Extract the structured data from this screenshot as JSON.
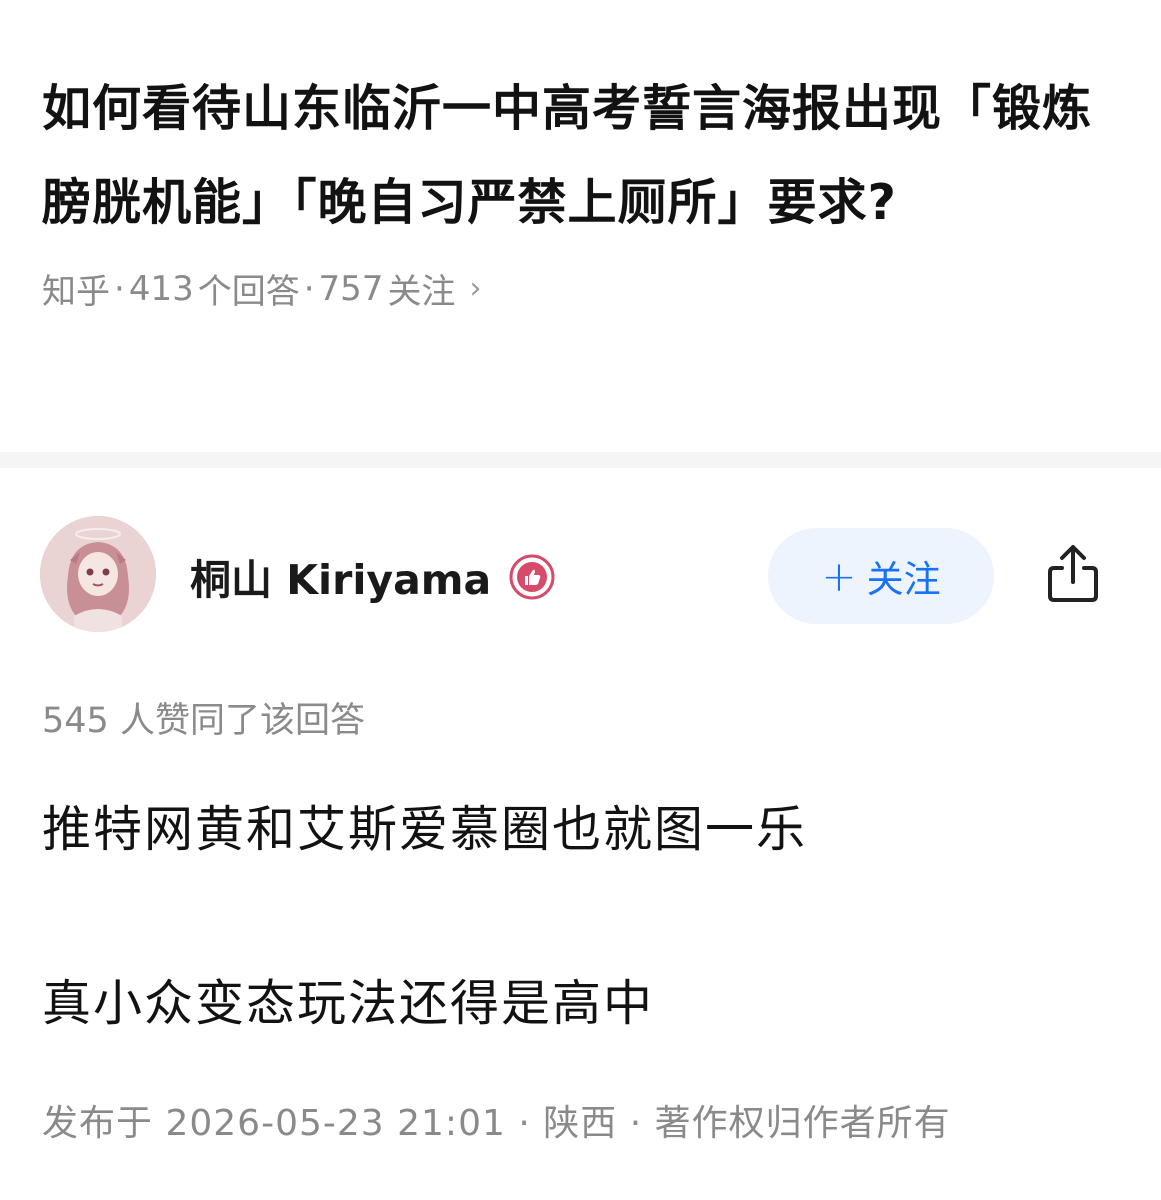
{
  "question": {
    "title": "如何看待山东临沂一中高考誓言海报出现「锻炼膀胱机能」「晚自习严禁上厕所」要求?",
    "source": "知乎",
    "answers_count": "413",
    "answers_label": "个回答",
    "followers_count": "757",
    "followers_label": "关注",
    "separator": "·"
  },
  "author": {
    "name": "桐山 Kiriyama",
    "badge_icon": "thumbs-up-badge-icon",
    "follow_label": "关注",
    "follow_plus": "+",
    "share_icon": "share-icon"
  },
  "answer": {
    "upvote_count": "545",
    "upvote_label": "人赞同了该回答",
    "paragraphs": [
      "推特网黄和艾斯爱慕圈也就图一乐",
      "真小众变态玩法还得是高中"
    ],
    "publish_prefix": "发布于",
    "publish_time": "2026-05-23  21:01",
    "location": "陕西",
    "copyright": "著作权归作者所有"
  },
  "colors": {
    "accent": "#1772f6",
    "follow_bg": "#eef4fd",
    "meta_gray": "#8a8a8a",
    "badge_red": "#d64a6a"
  }
}
